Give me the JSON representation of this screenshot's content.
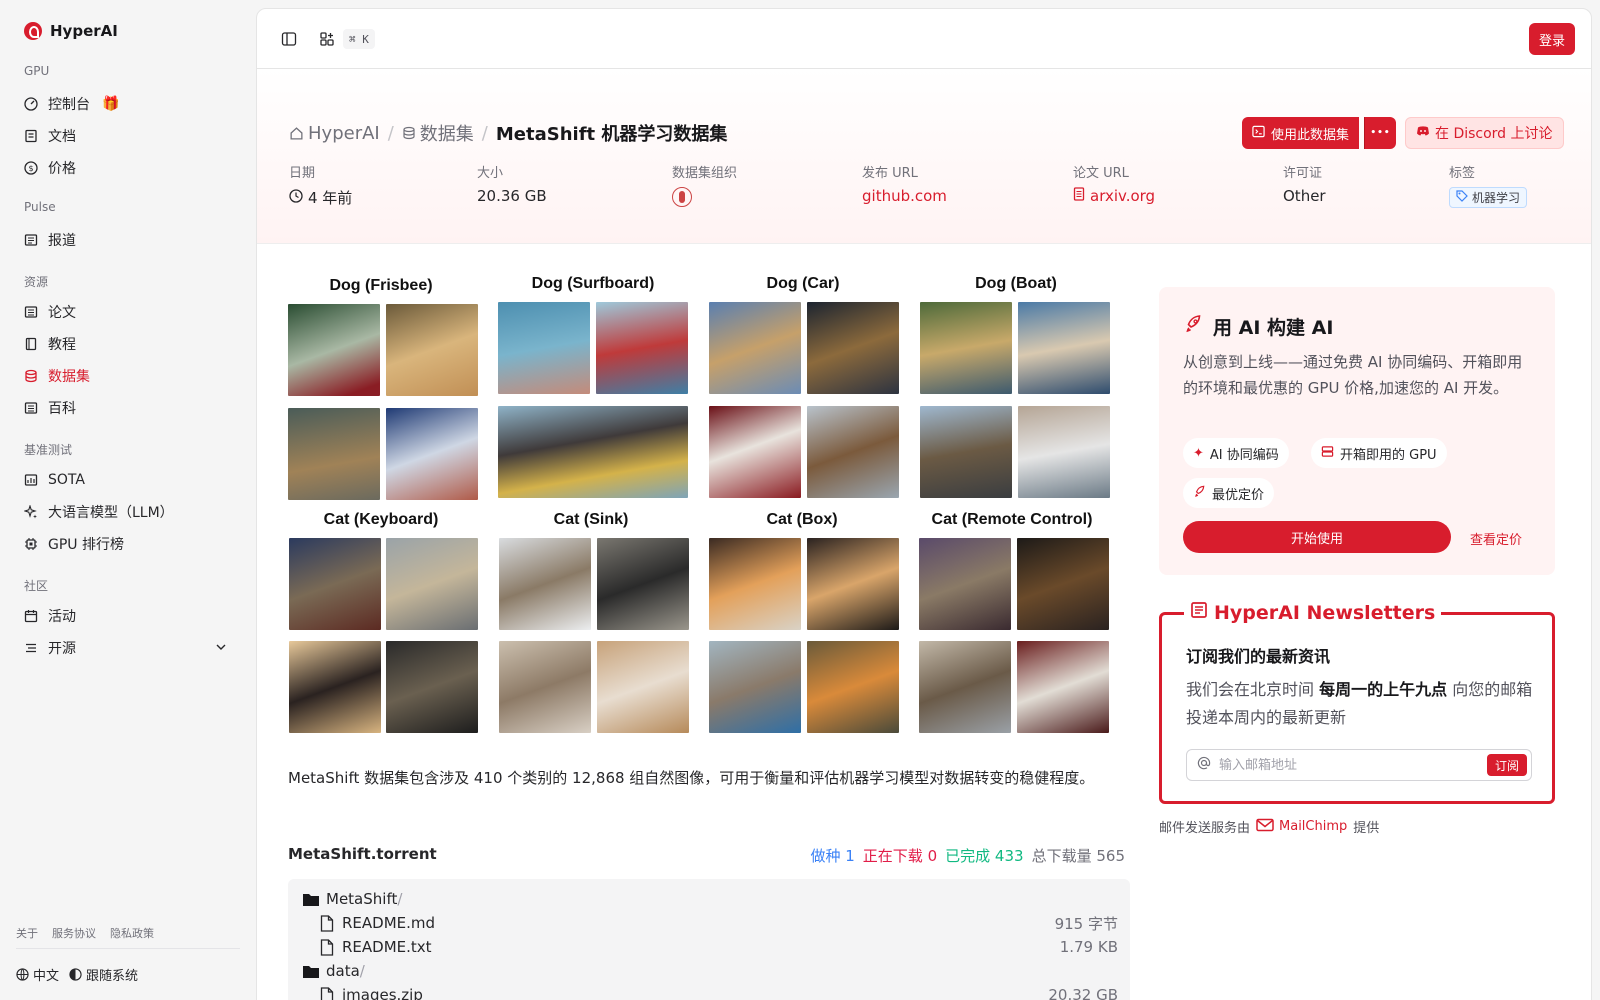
{
  "app": {
    "brand": "HyperAI"
  },
  "sidebar": {
    "sections": [
      {
        "title": "GPU",
        "items": [
          {
            "label": "控制台",
            "icon": "gauge-icon"
          },
          {
            "label": "文档",
            "icon": "book-icon"
          },
          {
            "label": "价格",
            "icon": "dollar-icon"
          }
        ]
      },
      {
        "title": "Pulse",
        "items": [
          {
            "label": "报道",
            "icon": "newspaper-icon"
          }
        ]
      },
      {
        "title": "资源",
        "items": [
          {
            "label": "论文",
            "icon": "paper-icon"
          },
          {
            "label": "教程",
            "icon": "notebook-icon"
          },
          {
            "label": "数据集",
            "icon": "database-icon",
            "active": true
          },
          {
            "label": "百科",
            "icon": "encyclopedia-icon"
          }
        ]
      },
      {
        "title": "基准测试",
        "items": [
          {
            "label": "SOTA",
            "icon": "chart-icon"
          },
          {
            "label": "大语言模型（LLM）",
            "icon": "sparkle-icon"
          },
          {
            "label": "GPU 排行榜",
            "icon": "chip-icon"
          }
        ]
      },
      {
        "title": "社区",
        "items": [
          {
            "label": "活动",
            "icon": "calendar-icon"
          },
          {
            "label": "开源",
            "icon": "list-icon"
          }
        ]
      }
    ],
    "footer_links": [
      "关于",
      "服务协议",
      "隐私政策"
    ],
    "language": "中文",
    "theme": "跟随系统"
  },
  "topbar": {
    "shortcut": "⌘ K",
    "login": "登录"
  },
  "breadcrumb": {
    "home": "HyperAI",
    "section": "数据集",
    "current": "MetaShift 机器学习数据集"
  },
  "actions": {
    "use": "使用此数据集",
    "more": "•••",
    "discord": "在 Discord 上讨论"
  },
  "meta": {
    "date_label": "日期",
    "date": "4 年前",
    "size_label": "大小",
    "size": "20.36 GB",
    "org_label": "数据集组织",
    "release_label": "发布 URL",
    "release": "github.com",
    "paper_label": "论文 URL",
    "paper": "arxiv.org",
    "license_label": "许可证",
    "license": "Other",
    "tags_label": "标签",
    "tag": "机器学习"
  },
  "figure": {
    "groups": [
      "Dog (Frisbee)",
      "Dog (Surfboard)",
      "Dog (Car)",
      "Dog (Boat)",
      "Cat (Keyboard)",
      "Cat (Sink)",
      "Cat (Box)",
      "Cat (Remote Control)"
    ]
  },
  "description": "MetaShift 数据集包含涉及 410 个类别的 12,868 组自然图像，可用于衡量和评估机器学习模型对数据转变的稳健程度。",
  "torrent": {
    "title": "MetaShift.torrent",
    "seed_label": "做种",
    "seed": "1",
    "down_label": "正在下载",
    "down": "0",
    "done_label": "已完成",
    "done": "433",
    "total_label": "总下载量",
    "total": "565",
    "files": [
      {
        "name": "MetaShift",
        "type": "folder",
        "size": ""
      },
      {
        "name": "README.md",
        "type": "file",
        "size": "915 字节"
      },
      {
        "name": "README.txt",
        "type": "file",
        "size": "1.79 KB"
      },
      {
        "name": "data",
        "type": "folder",
        "size": ""
      },
      {
        "name": "images.zip",
        "type": "file",
        "size": "20.32 GB"
      }
    ]
  },
  "ai_card": {
    "title": "用 AI 构建 AI",
    "text": "从创意到上线——通过免费 AI 协同编码、开箱即用的环境和最优惠的 GPU 价格,加速您的 AI 开发。",
    "pills": [
      "AI 协同编码",
      "开箱即用的 GPU",
      "最优定价"
    ],
    "start": "开始使用",
    "pricing": "查看定价"
  },
  "newsletter": {
    "title": "HyperAI Newsletters",
    "heading": "订阅我们的最新资讯",
    "text_pre": "我们会在北京时间 ",
    "text_bold": "每周一的上午九点",
    "text_post": " 向您的邮箱投递本周内的最新更新",
    "placeholder": "输入邮箱地址",
    "subscribe": "订阅",
    "note_pre": "邮件发送服务由",
    "note_brand": "MailChimp",
    "note_post": "提供"
  }
}
